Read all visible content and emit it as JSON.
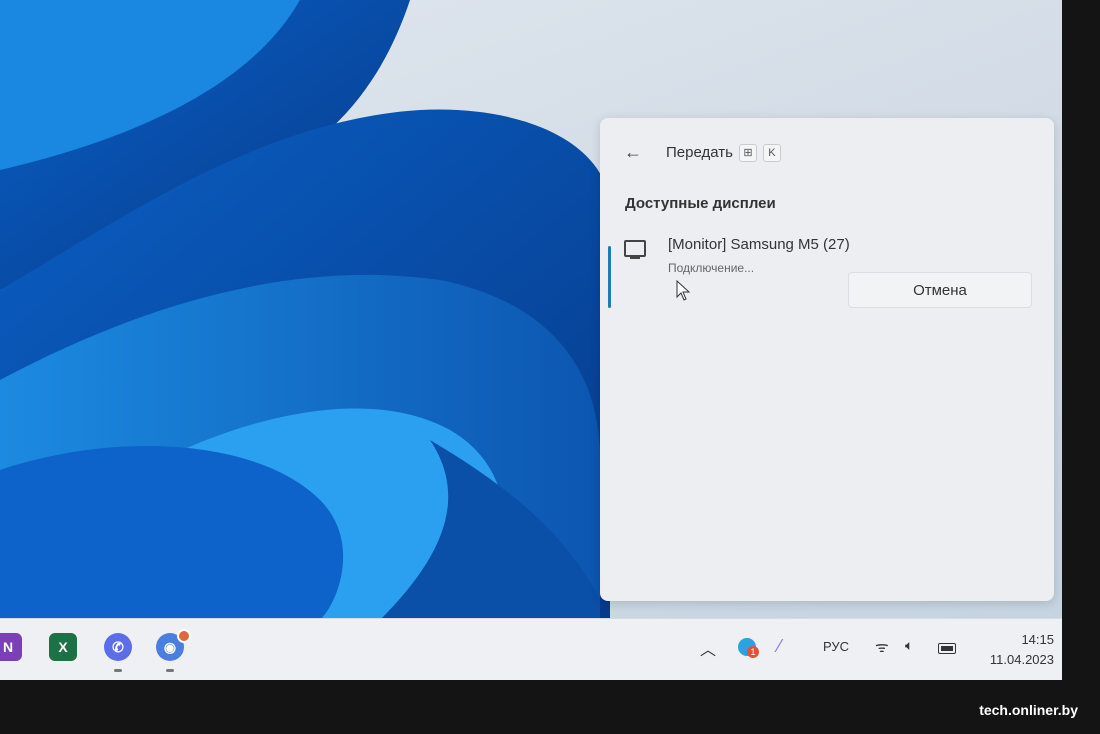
{
  "cast_panel": {
    "title": "Передать",
    "shortcut_keys": [
      "⊞",
      "K"
    ],
    "section": "Доступные дисплеи",
    "device": {
      "name": "[Monitor] Samsung M5 (27)",
      "status": "Подключение...",
      "cancel_label": "Отмена"
    }
  },
  "taskbar": {
    "apps": [
      {
        "name": "OneNote",
        "glyph": "N",
        "color": "#7b3fb8"
      },
      {
        "name": "Excel",
        "glyph": "X",
        "color": "#1e7145"
      },
      {
        "name": "Viber",
        "glyph": "✆",
        "color": "#5b6ee8"
      },
      {
        "name": "Discord",
        "glyph": "◉",
        "color": "#4a7fe0"
      }
    ],
    "telegram_badge": "1",
    "language": "РУС",
    "time": "14:15",
    "date": "11.04.2023"
  },
  "watermark": "tech.onliner.by"
}
